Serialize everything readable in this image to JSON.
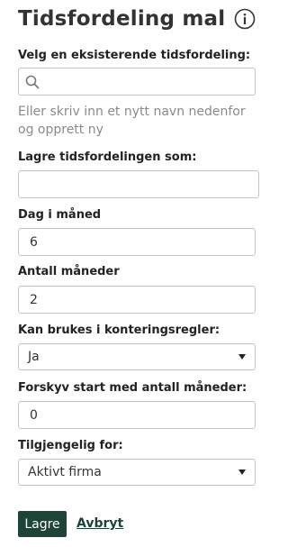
{
  "header": {
    "title": "Tidsfordeling mal",
    "info_icon": "info-circle-icon"
  },
  "existing": {
    "label": "Velg en eksisterende tidsfordeling:",
    "search_placeholder": "",
    "search_icon": "search-icon",
    "helper": "Eller skriv inn et nytt navn nedenfor og opprett ny"
  },
  "save_as": {
    "label": "Lagre tidsfordelingen som:",
    "value": ""
  },
  "day_of_month": {
    "label": "Dag i måned",
    "value": "6"
  },
  "months_count": {
    "label": "Antall måneder",
    "value": "2"
  },
  "posting_rules": {
    "label": "Kan brukes i konteringsregler:",
    "selected": "Ja"
  },
  "offset_months": {
    "label": "Forskyv start med antall måneder:",
    "value": "0"
  },
  "available_for": {
    "label": "Tilgjengelig for:",
    "selected": "Aktivt firma"
  },
  "actions": {
    "save_label": "Lagre",
    "cancel_label": "Avbryt"
  },
  "colors": {
    "primary": "#1d4436",
    "border": "#c4c4c4",
    "helper_text": "#8a8a8a"
  }
}
